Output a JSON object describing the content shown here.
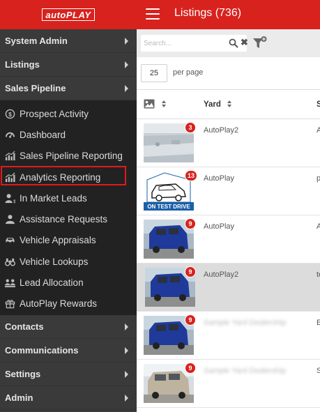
{
  "header": {
    "logo_left": "auto",
    "logo_right": "PLAY",
    "title": "Listings (736)"
  },
  "sidebar": {
    "sections_top": [
      {
        "label": "System Admin"
      },
      {
        "label": "Listings"
      },
      {
        "label": "Sales Pipeline"
      }
    ],
    "sales_pipeline_items": [
      {
        "label": "Prospect Activity",
        "icon": "prospect-activity-icon"
      },
      {
        "label": "Dashboard",
        "icon": "dashboard-icon"
      },
      {
        "label": "Sales Pipeline Reporting",
        "icon": "chart-icon"
      },
      {
        "label": "Analytics Reporting",
        "icon": "chart-icon"
      },
      {
        "label": "In Market Leads",
        "icon": "user-dollar-icon"
      },
      {
        "label": "Assistance Requests",
        "icon": "user-help-icon"
      },
      {
        "label": "Vehicle Appraisals",
        "icon": "car-icon"
      },
      {
        "label": "Vehicle Lookups",
        "icon": "binoculars-icon"
      },
      {
        "label": "Lead Allocation",
        "icon": "users-icon"
      },
      {
        "label": "AutoPlay Rewards",
        "icon": "gift-icon"
      }
    ],
    "sections_bottom": [
      {
        "label": "Contacts"
      },
      {
        "label": "Communications"
      },
      {
        "label": "Settings"
      },
      {
        "label": "Admin"
      }
    ]
  },
  "toolbar": {
    "search_placeholder": "Search..."
  },
  "pagination": {
    "per_page_value": "25",
    "per_page_label": "per page"
  },
  "table": {
    "columns": {
      "yard": "Yard",
      "third": "S"
    },
    "rows": [
      {
        "badge": "3",
        "yard": "AutoPlay2",
        "col3": "A",
        "photo": "snow-yard",
        "blurred": false,
        "selected": false
      },
      {
        "badge": "13",
        "yard": "AutoPlay",
        "col3": "p",
        "photo": "on-test-drive",
        "caption": "ON TEST DRIVE",
        "blurred": false,
        "selected": false
      },
      {
        "badge": "9",
        "yard": "AutoPlay",
        "col3": "A",
        "photo": "blue-van",
        "blurred": false,
        "selected": false
      },
      {
        "badge": "9",
        "yard": "AutoPlay2",
        "col3": "te",
        "photo": "blue-van",
        "blurred": false,
        "selected": true
      },
      {
        "badge": "9",
        "yard": "Sample Yard Dealership",
        "col3": "E",
        "photo": "blue-van",
        "blurred": true,
        "selected": false
      },
      {
        "badge": "9",
        "yard": "Sample Yard Dealership",
        "col3": "S",
        "photo": "silver-van",
        "blurred": true,
        "selected": false
      }
    ]
  },
  "colors": {
    "brand_red": "#d8221d",
    "sidebar_bg": "#3a3a3a",
    "submenu_bg": "#222222",
    "highlight_border": "#e11a1a"
  }
}
